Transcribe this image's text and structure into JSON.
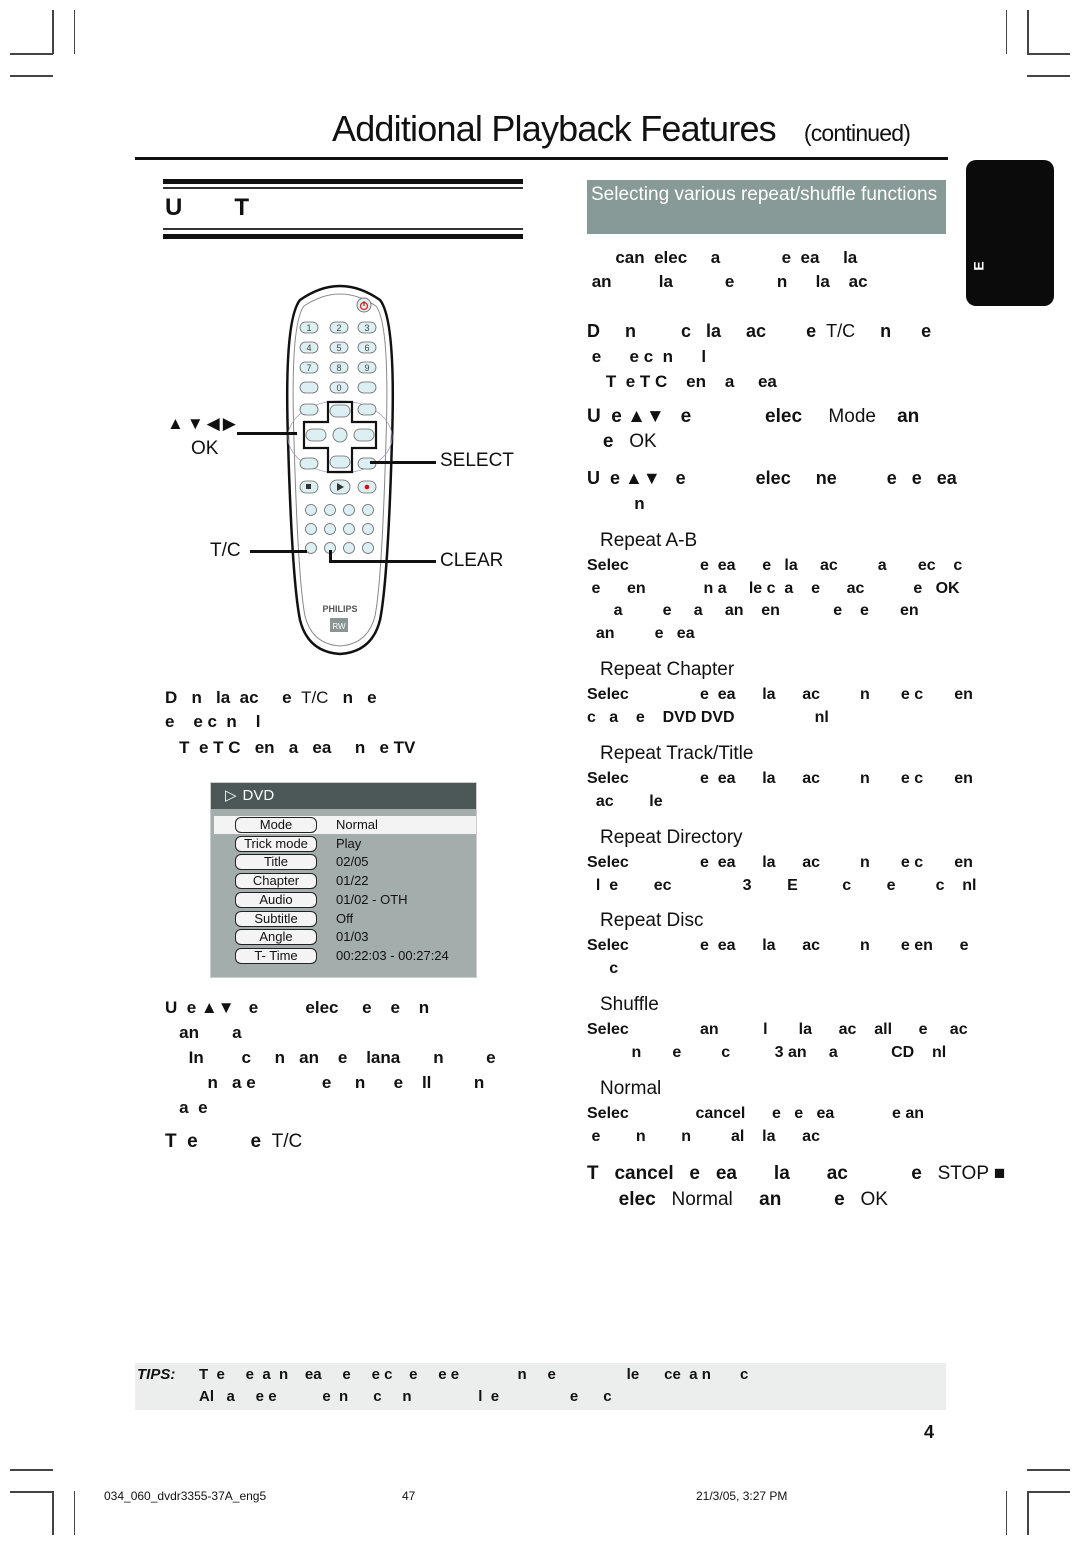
{
  "header": {
    "title": "Additional Playback Features",
    "continued": "(continued)"
  },
  "lang_tab": "E",
  "left_section": {
    "heading_parts": [
      "U",
      "T"
    ],
    "remote": {
      "brand": "PHILIPS",
      "logo": "RW",
      "callouts": {
        "arrows": "▲▼◀▶",
        "ok": "OK",
        "select": "SELECT",
        "tc": "T/C",
        "clear": "CLEAR"
      }
    },
    "step1": [
      {
        "t": "D   n   la  ac     e  ",
        "b": true
      },
      {
        "t": "T/C",
        "b": false
      },
      {
        "t": "   n   e",
        "b": true
      }
    ],
    "step1_line2": "e    e c  n    l",
    "step1_line3": "   T  e T C   en   a   ea     n   e TV",
    "dvd_panel": {
      "header": "DVD",
      "rows": [
        {
          "label": "Mode",
          "value": "Normal",
          "selected": true
        },
        {
          "label": "Trick mode",
          "value": "Play",
          "selected": false
        },
        {
          "label": "Title",
          "value": "02/05",
          "selected": false
        },
        {
          "label": "Chapter",
          "value": "01/22",
          "selected": false
        },
        {
          "label": "Audio",
          "value": "01/02 - OTH",
          "selected": false
        },
        {
          "label": "Subtitle",
          "value": "Off",
          "selected": false
        },
        {
          "label": "Angle",
          "value": "01/03",
          "selected": false
        },
        {
          "label": "T- Time",
          "value": "00:22:03 - 00:27:24",
          "selected": false
        }
      ]
    },
    "step2_lines": [
      "U  e ▲▼   e          elec     e    e    n",
      "   an       a",
      "     In        c     n   an    e    lana       n         e",
      "         n   a e              e     n      e    ll         n",
      "   a  e"
    ],
    "step3": {
      "pre": "T  e          e  ",
      "key": "T/C"
    }
  },
  "right_section": {
    "heading": "Selecting various repeat/shuffle functions",
    "intro": [
      "      can  elec     a             e  ea     la",
      " an          la           e         n      la    ac"
    ],
    "step1": {
      "l1a": "D     n         c   la     ac        e  ",
      "l1k": "T/C",
      "l1b": "     n      e",
      "l2": " e      e c  n      l",
      "l3": "    T  e T C    en    a     ea"
    },
    "step2": {
      "a": "U  e ▲▼   e              elec     ",
      "k1": "Mode",
      "b": "    an",
      "c": "   e   ",
      "k2": "OK"
    },
    "step3": {
      "l1": "U  e ▲▼   e              elec     ne          e   e   ea",
      "l2": "          n"
    },
    "options": [
      {
        "name": "Repeat A-B",
        "lines": [
          "Selec                e  ea      e   la     ac         a       ec    c",
          " e      en             n a     le c  a    e      ac           e   OK",
          "      a         e     a     an    en            e    e       en",
          "  an         e   ea"
        ]
      },
      {
        "name": "Repeat Chapter",
        "lines": [
          "Selec                e  ea      la      ac         n       e c       en",
          "c   a    e    DVD DVD                  nl"
        ]
      },
      {
        "name": "Repeat Track/Title",
        "lines": [
          "Selec                e  ea      la      ac         n       e c       en",
          "  ac        le"
        ]
      },
      {
        "name": "Repeat Directory",
        "lines": [
          "Selec                e  ea      la      ac         n       e c       en",
          "  l  e        ec                3        E          c        e         c    nl"
        ]
      },
      {
        "name": "Repeat Disc",
        "lines": [
          "Selec                e  ea      la      ac         n       e en      e",
          "     c"
        ]
      },
      {
        "name": "Shuffle",
        "lines": [
          "Selec                an          l       la      ac    all      e     ac",
          "          n       e         c          3 an     a            CD    nl"
        ]
      },
      {
        "name": "Normal",
        "lines": [
          "Selec               cancel      e   e   ea             e an",
          " e        n        n         al    la      ac"
        ]
      }
    ],
    "cancel": {
      "a": "T   cancel   e   ea       la       ac            e   ",
      "k1": "STOP ■",
      "b": "      elec   ",
      "k2": "Normal",
      "c": "     an          e   ",
      "k3": "OK"
    }
  },
  "tips": {
    "label": "TIPS:",
    "line1": "T  e     e  a  n    ea     e     e c    e     e e              n     e                 le      ce  a n       c",
    "line2": "Al   a     e e           e  n      c     n                l  e                 e      c"
  },
  "page_number": "4",
  "footer": {
    "file": "034_060_dvdr3355-37A_eng5",
    "page": "47",
    "date": "21/3/05, 3:27 PM"
  }
}
